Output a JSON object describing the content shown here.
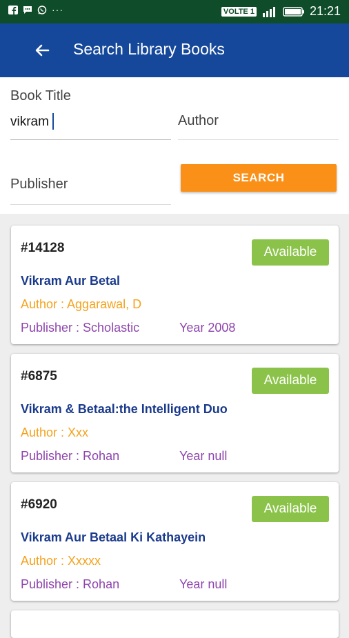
{
  "status_bar": {
    "left_icons": [
      "facebook-icon",
      "chat-icon",
      "whatsapp-icon"
    ],
    "dots": "···",
    "network": "VOLTE 1",
    "time": "21:21"
  },
  "app_bar": {
    "title": "Search Library Books"
  },
  "form": {
    "book_title_label": "Book Title",
    "book_title_value": "vikram",
    "author_placeholder": "Author",
    "publisher_placeholder": "Publisher",
    "search_label": "SEARCH"
  },
  "results": [
    {
      "id": "#14128",
      "status": "Available",
      "title": "Vikram Aur Betal",
      "author": "Author : Aggarawal, D",
      "publisher": "Publisher : Scholastic",
      "year": "Year 2008"
    },
    {
      "id": "#6875",
      "status": "Available",
      "title": "Vikram & Betaal:the Intelligent Duo",
      "author": "Author : Xxx",
      "publisher": "Publisher : Rohan",
      "year": "Year null"
    },
    {
      "id": "#6920",
      "status": "Available",
      "title": "Vikram Aur Betaal Ki Kathayein",
      "author": "Author : Xxxxx",
      "publisher": "Publisher : Rohan",
      "year": "Year null"
    }
  ],
  "colors": {
    "status_bar": "#0f4c2a",
    "app_bar": "#15489a",
    "search_button": "#fb9018",
    "available_badge": "#8bc34a",
    "title_text": "#1a3a8c",
    "author_text": "#f4a21c",
    "publisher_text": "#8e44ad"
  }
}
